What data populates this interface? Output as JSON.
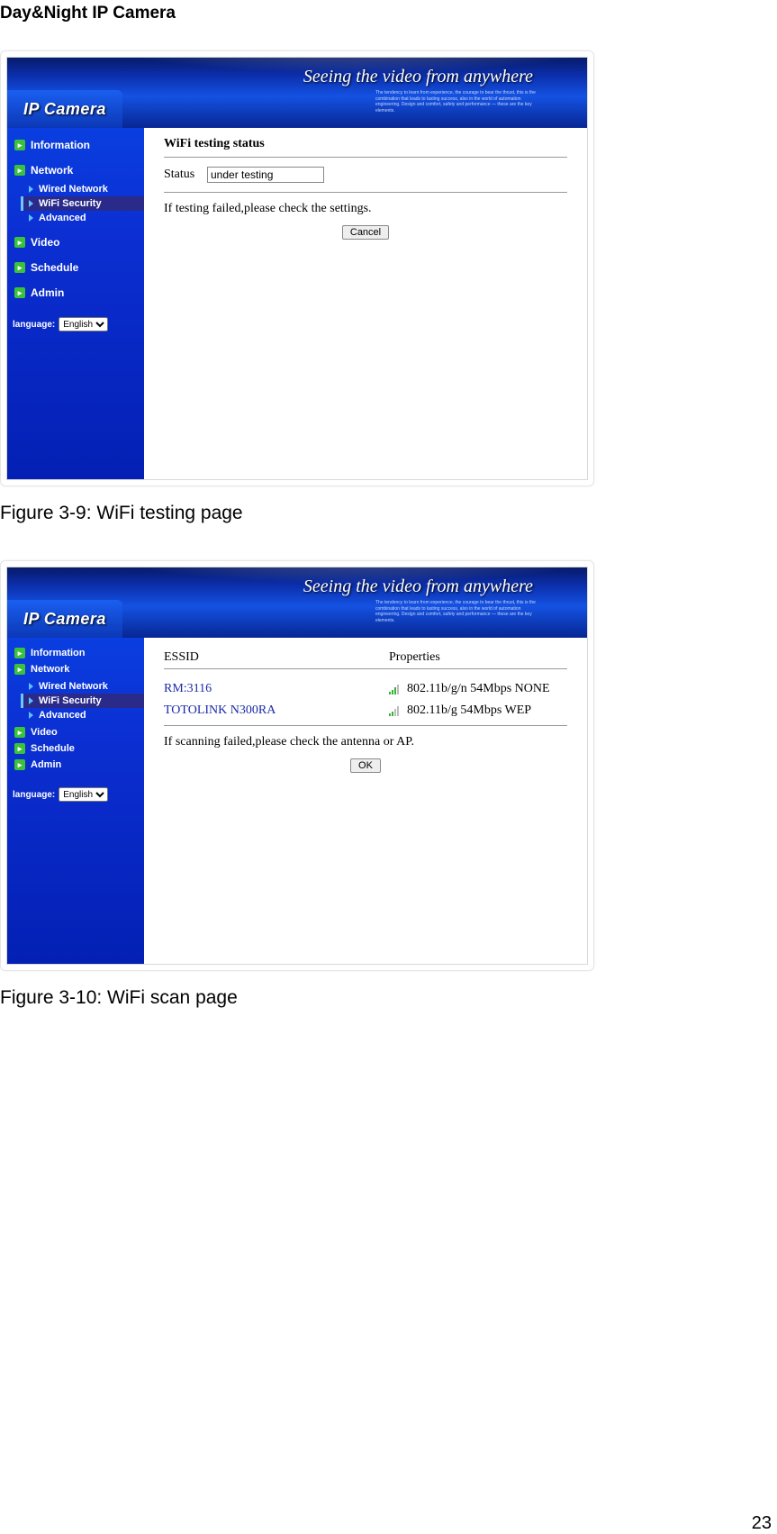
{
  "doc": {
    "title": "Day&Night IP Camera",
    "page_number": "23"
  },
  "shared": {
    "logo": "IP Camera",
    "tagline": "Seeing the video from anywhere",
    "language_label": "language:",
    "language_value": "English"
  },
  "sidebar": {
    "information": "Information",
    "network": "Network",
    "wired_network": "Wired Network",
    "wifi_security": "WiFi Security",
    "advanced": "Advanced",
    "video": "Video",
    "schedule": "Schedule",
    "admin": "Admin"
  },
  "fig1": {
    "caption": "Figure 3-9: WiFi testing page",
    "heading": "WiFi testing status",
    "status_label": "Status",
    "status_value": "under testing",
    "note": "If testing failed,please check the settings.",
    "cancel": "Cancel"
  },
  "fig2": {
    "caption": "Figure 3-10: WiFi scan page",
    "col_essid": "ESSID",
    "col_properties": "Properties",
    "rows": [
      {
        "essid": "RM:3116",
        "props": "802.11b/g/n 54Mbps NONE",
        "signal": 3
      },
      {
        "essid": "TOTOLINK N300RA",
        "props": "802.11b/g 54Mbps WEP",
        "signal": 2
      }
    ],
    "note": "If scanning failed,please check the antenna or AP.",
    "ok": "OK"
  }
}
